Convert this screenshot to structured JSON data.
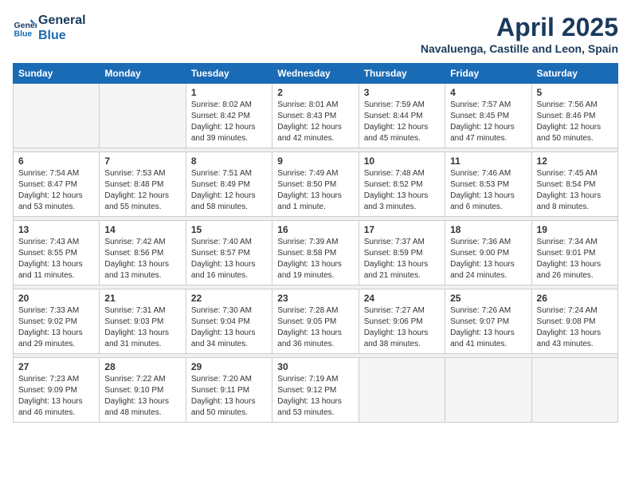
{
  "header": {
    "logo_line1": "General",
    "logo_line2": "Blue",
    "title": "April 2025",
    "subtitle": "Navaluenga, Castille and Leon, Spain"
  },
  "days_of_week": [
    "Sunday",
    "Monday",
    "Tuesday",
    "Wednesday",
    "Thursday",
    "Friday",
    "Saturday"
  ],
  "weeks": [
    [
      {
        "day": "",
        "info": ""
      },
      {
        "day": "",
        "info": ""
      },
      {
        "day": "1",
        "info": "Sunrise: 8:02 AM\nSunset: 8:42 PM\nDaylight: 12 hours and 39 minutes."
      },
      {
        "day": "2",
        "info": "Sunrise: 8:01 AM\nSunset: 8:43 PM\nDaylight: 12 hours and 42 minutes."
      },
      {
        "day": "3",
        "info": "Sunrise: 7:59 AM\nSunset: 8:44 PM\nDaylight: 12 hours and 45 minutes."
      },
      {
        "day": "4",
        "info": "Sunrise: 7:57 AM\nSunset: 8:45 PM\nDaylight: 12 hours and 47 minutes."
      },
      {
        "day": "5",
        "info": "Sunrise: 7:56 AM\nSunset: 8:46 PM\nDaylight: 12 hours and 50 minutes."
      }
    ],
    [
      {
        "day": "6",
        "info": "Sunrise: 7:54 AM\nSunset: 8:47 PM\nDaylight: 12 hours and 53 minutes."
      },
      {
        "day": "7",
        "info": "Sunrise: 7:53 AM\nSunset: 8:48 PM\nDaylight: 12 hours and 55 minutes."
      },
      {
        "day": "8",
        "info": "Sunrise: 7:51 AM\nSunset: 8:49 PM\nDaylight: 12 hours and 58 minutes."
      },
      {
        "day": "9",
        "info": "Sunrise: 7:49 AM\nSunset: 8:50 PM\nDaylight: 13 hours and 1 minute."
      },
      {
        "day": "10",
        "info": "Sunrise: 7:48 AM\nSunset: 8:52 PM\nDaylight: 13 hours and 3 minutes."
      },
      {
        "day": "11",
        "info": "Sunrise: 7:46 AM\nSunset: 8:53 PM\nDaylight: 13 hours and 6 minutes."
      },
      {
        "day": "12",
        "info": "Sunrise: 7:45 AM\nSunset: 8:54 PM\nDaylight: 13 hours and 8 minutes."
      }
    ],
    [
      {
        "day": "13",
        "info": "Sunrise: 7:43 AM\nSunset: 8:55 PM\nDaylight: 13 hours and 11 minutes."
      },
      {
        "day": "14",
        "info": "Sunrise: 7:42 AM\nSunset: 8:56 PM\nDaylight: 13 hours and 13 minutes."
      },
      {
        "day": "15",
        "info": "Sunrise: 7:40 AM\nSunset: 8:57 PM\nDaylight: 13 hours and 16 minutes."
      },
      {
        "day": "16",
        "info": "Sunrise: 7:39 AM\nSunset: 8:58 PM\nDaylight: 13 hours and 19 minutes."
      },
      {
        "day": "17",
        "info": "Sunrise: 7:37 AM\nSunset: 8:59 PM\nDaylight: 13 hours and 21 minutes."
      },
      {
        "day": "18",
        "info": "Sunrise: 7:36 AM\nSunset: 9:00 PM\nDaylight: 13 hours and 24 minutes."
      },
      {
        "day": "19",
        "info": "Sunrise: 7:34 AM\nSunset: 9:01 PM\nDaylight: 13 hours and 26 minutes."
      }
    ],
    [
      {
        "day": "20",
        "info": "Sunrise: 7:33 AM\nSunset: 9:02 PM\nDaylight: 13 hours and 29 minutes."
      },
      {
        "day": "21",
        "info": "Sunrise: 7:31 AM\nSunset: 9:03 PM\nDaylight: 13 hours and 31 minutes."
      },
      {
        "day": "22",
        "info": "Sunrise: 7:30 AM\nSunset: 9:04 PM\nDaylight: 13 hours and 34 minutes."
      },
      {
        "day": "23",
        "info": "Sunrise: 7:28 AM\nSunset: 9:05 PM\nDaylight: 13 hours and 36 minutes."
      },
      {
        "day": "24",
        "info": "Sunrise: 7:27 AM\nSunset: 9:06 PM\nDaylight: 13 hours and 38 minutes."
      },
      {
        "day": "25",
        "info": "Sunrise: 7:26 AM\nSunset: 9:07 PM\nDaylight: 13 hours and 41 minutes."
      },
      {
        "day": "26",
        "info": "Sunrise: 7:24 AM\nSunset: 9:08 PM\nDaylight: 13 hours and 43 minutes."
      }
    ],
    [
      {
        "day": "27",
        "info": "Sunrise: 7:23 AM\nSunset: 9:09 PM\nDaylight: 13 hours and 46 minutes."
      },
      {
        "day": "28",
        "info": "Sunrise: 7:22 AM\nSunset: 9:10 PM\nDaylight: 13 hours and 48 minutes."
      },
      {
        "day": "29",
        "info": "Sunrise: 7:20 AM\nSunset: 9:11 PM\nDaylight: 13 hours and 50 minutes."
      },
      {
        "day": "30",
        "info": "Sunrise: 7:19 AM\nSunset: 9:12 PM\nDaylight: 13 hours and 53 minutes."
      },
      {
        "day": "",
        "info": ""
      },
      {
        "day": "",
        "info": ""
      },
      {
        "day": "",
        "info": ""
      }
    ]
  ]
}
